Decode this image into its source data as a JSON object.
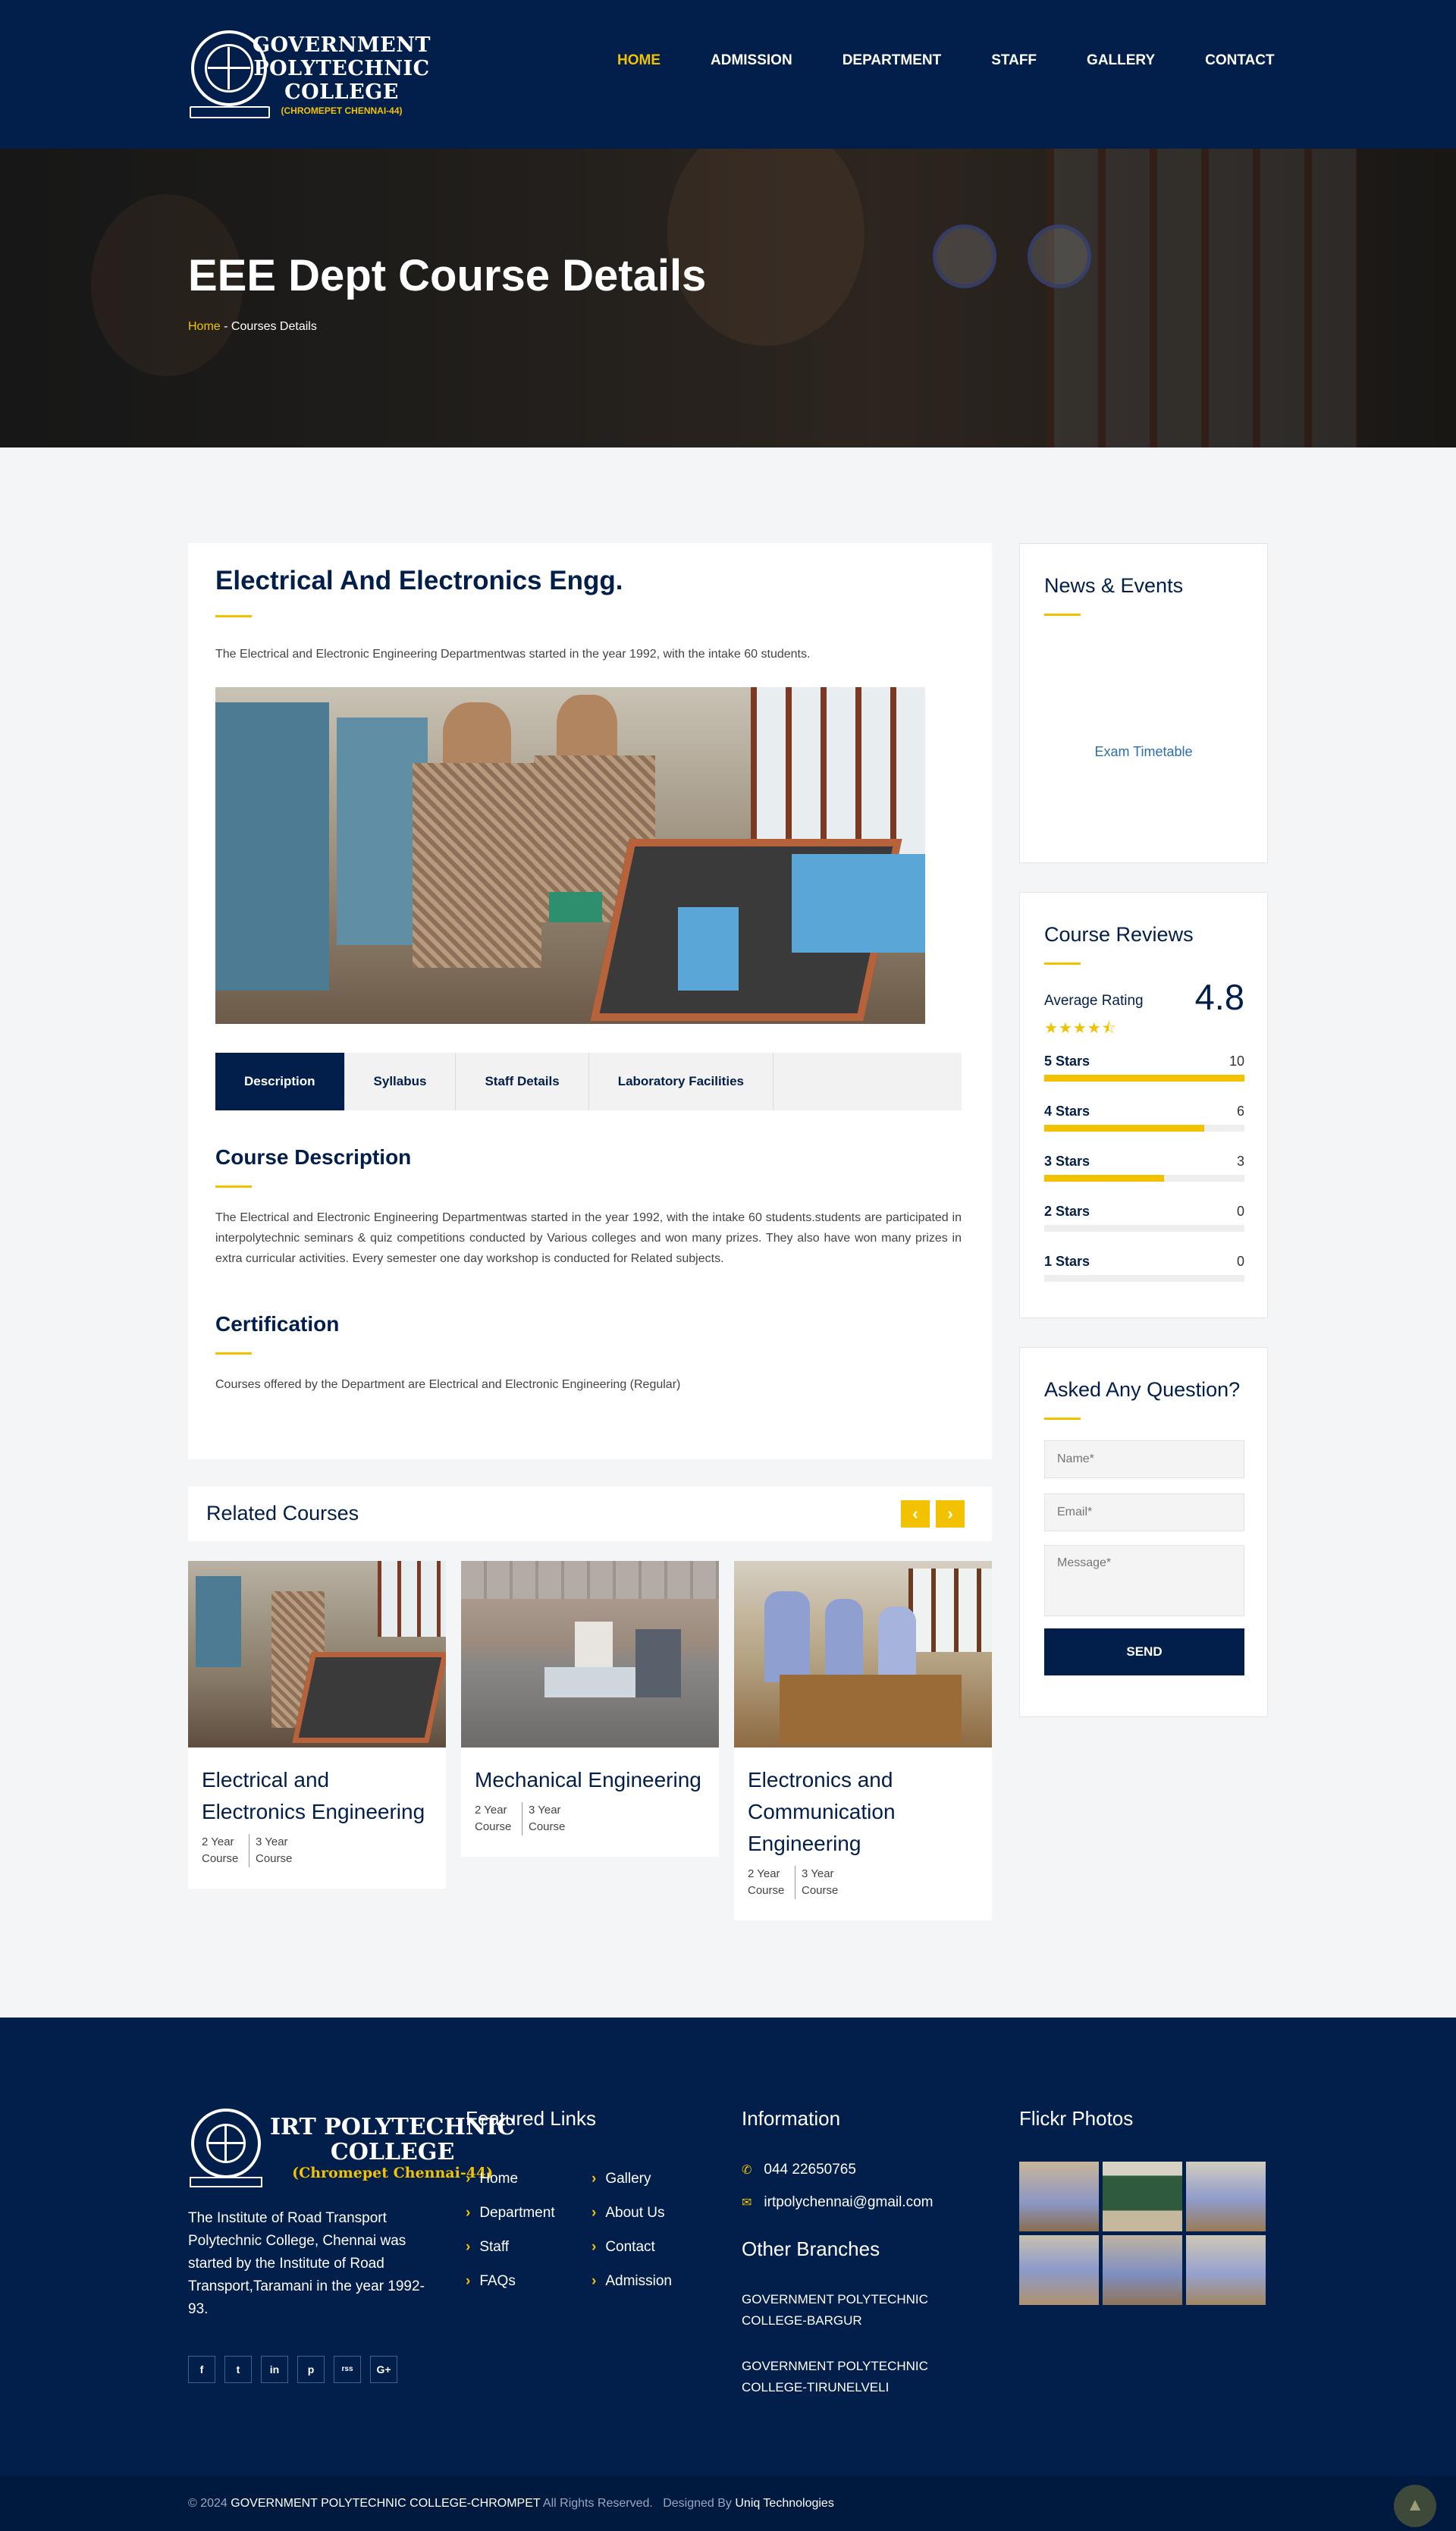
{
  "header": {
    "logo_lines": [
      "GOVERNMENT",
      "POLYTECHNIC",
      "COLLEGE"
    ],
    "logo_sub": "(CHROMEPET CHENNAI-44)",
    "nav": [
      "HOME",
      "ADMISSION",
      "DEPARTMENT",
      "STAFF",
      "GALLERY",
      "CONTACT"
    ]
  },
  "hero": {
    "title": "EEE Dept Course Details",
    "breadcrumb_home": "Home",
    "breadcrumb_sep": " - ",
    "breadcrumb_current": "Courses Details"
  },
  "course": {
    "title": "Electrical And Electronics Engg.",
    "intro": "The Electrical and Electronic Engineering Departmentwas started in the year 1992, with the intake 60 students.",
    "tabs": [
      "Description",
      "Syllabus",
      "Staff Details",
      "Laboratory Facilities"
    ],
    "desc_title": "Course Description",
    "desc_text": "The Electrical and Electronic Engineering Departmentwas started in the year 1992, with the intake 60 students.students are participated in interpolytechnic seminars & quiz competitions conducted by Various colleges and won many prizes. They also have won many prizes in extra curricular activities. Every semester one day workshop is conducted for Related subjects.",
    "cert_title": "Certification",
    "cert_text": "Courses offered by the Department are Electrical and Electronic Engineering (Regular)"
  },
  "related": {
    "title": "Related Courses",
    "prev_icon": "‹",
    "next_icon": "›",
    "courses": [
      {
        "name": "Electrical and Electronics Engineering",
        "meta1": "2 Year Course",
        "meta2": "3 Year Course"
      },
      {
        "name": "Mechanical Engineering",
        "meta1": "2 Year Course",
        "meta2": "3 Year Course"
      },
      {
        "name": "Electronics and Communication Engineering",
        "meta1": "2 Year Course",
        "meta2": "3 Year Course"
      }
    ]
  },
  "sidebar": {
    "news_title": "News & Events",
    "news_item": "Exam Timetable",
    "reviews_title": "Course Reviews",
    "avg_label": "Average Rating",
    "avg_value": "4.8",
    "avg_stars": "★★★★⯪",
    "ratings": [
      {
        "label": "5 Stars",
        "count": "10",
        "fill": 1.0
      },
      {
        "label": "4 Stars",
        "count": "6",
        "fill": 0.8
      },
      {
        "label": "3 Stars",
        "count": "3",
        "fill": 0.6
      },
      {
        "label": "2 Stars",
        "count": "0",
        "fill": 0
      },
      {
        "label": "1 Stars",
        "count": "0",
        "fill": 0
      }
    ],
    "question_title": "Asked Any Question?",
    "name_placeholder": "Name*",
    "email_placeholder": "Email*",
    "message_placeholder": "Message*",
    "send_label": "SEND"
  },
  "footer": {
    "logo_lines": [
      "IRT POLYTECHNIC",
      "COLLEGE"
    ],
    "logo_sub": "(Chromepet Chennai-44)",
    "about": "The Institute of Road Transport Polytechnic College, Chennai was started by the Institute of Road Transport,Taramani in the year 1992-93.",
    "social": [
      "f",
      "t",
      "in",
      "p",
      "rss",
      "G+"
    ],
    "featured_title": "Featured Links",
    "links_col1": [
      "Home",
      "Department",
      "Staff",
      "FAQs"
    ],
    "links_col2": [
      "Gallery",
      "About Us",
      "Contact",
      "Admission"
    ],
    "info_title": "Information",
    "phone": "044 22650765",
    "email": "irtpolychennai@gmail.com",
    "branches_title": "Other Branches",
    "branches": [
      "GOVERNMENT POLYTECHNIC COLLEGE-BARGUR",
      "GOVERNMENT POLYTECHNIC COLLEGE-TIRUNELVELI"
    ],
    "flickr_title": "Flickr Photos",
    "copy_prefix": "© 2024 ",
    "copy_college": "GOVERNMENT POLYTECHNIC COLLEGE-CHROMPET",
    "copy_rights": " All Rights Reserved.   Designed By ",
    "copy_designer": "Uniq Technologies"
  },
  "colors": {
    "navy": "#021e4a",
    "accent": "#f2c200",
    "link": "#2a6db0"
  }
}
